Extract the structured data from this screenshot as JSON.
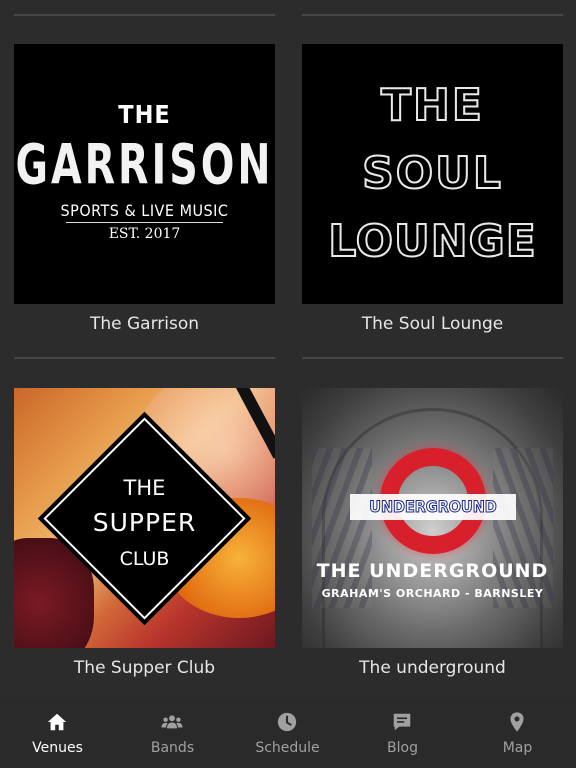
{
  "venues": [
    {
      "name": "The Garrison",
      "logo": {
        "line1": "THE",
        "line2": "GARRISON",
        "line3": "SPORTS & LIVE MUSIC",
        "line4": "EST. 2017"
      }
    },
    {
      "name": "The Soul Lounge",
      "logo": {
        "line1": "THE",
        "line2": "SOUL",
        "line3": "LOUNGE"
      }
    },
    {
      "name": "The Supper Club",
      "logo": {
        "line1": "THE",
        "line2": "SUPPER",
        "line3": "CLUB"
      }
    },
    {
      "name": "The underground",
      "logo": {
        "sign": "UNDERGROUND",
        "line1": "THE UNDERGROUND",
        "line2": "GRAHAM'S ORCHARD - BARNSLEY"
      }
    }
  ],
  "tabs": [
    {
      "label": "Venues",
      "icon": "home-icon",
      "active": true
    },
    {
      "label": "Bands",
      "icon": "users-icon",
      "active": false
    },
    {
      "label": "Schedule",
      "icon": "clock-icon",
      "active": false
    },
    {
      "label": "Blog",
      "icon": "message-icon",
      "active": false
    },
    {
      "label": "Map",
      "icon": "map-pin-icon",
      "active": false
    }
  ],
  "colors": {
    "background": "#2c2c2c",
    "tab_active": "#ffffff",
    "tab_inactive": "#a0a0a0"
  }
}
